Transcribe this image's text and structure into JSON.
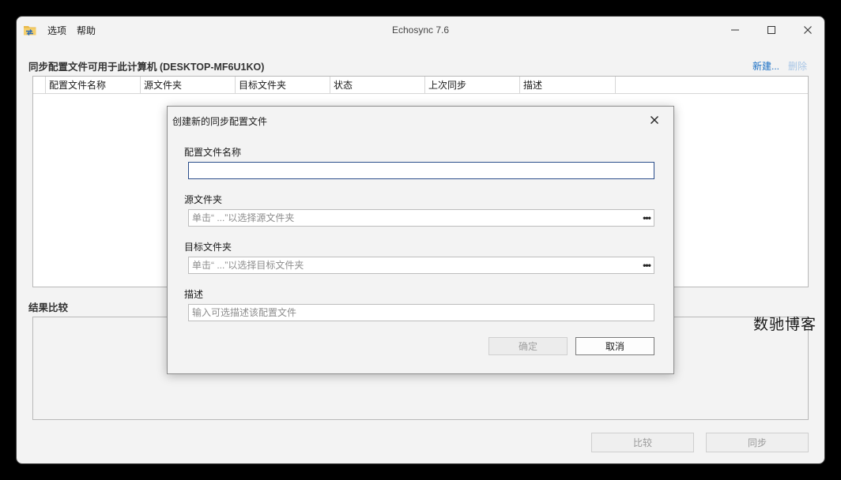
{
  "window": {
    "title": "Echosync 7.6",
    "menu": {
      "options": "选项",
      "help": "帮助"
    }
  },
  "profiles": {
    "heading": "同步配置文件可用于此计算机 (DESKTOP-MF6U1KO)",
    "new_link": "新建...",
    "delete_link": "删除",
    "columns": [
      "配置文件名称",
      "源文件夹",
      "目标文件夹",
      "状态",
      "上次同步",
      "描述"
    ]
  },
  "compare": {
    "heading": "结果比较"
  },
  "bottom_buttons": {
    "compare": "比较",
    "sync": "同步"
  },
  "dialog": {
    "title": "创建新的同步配置文件",
    "name_label": "配置文件名称",
    "name_value": "",
    "source_label": "源文件夹",
    "source_placeholder": "单击“ ...”以选择源文件夹",
    "target_label": "目标文件夹",
    "target_placeholder": "单击“ ...”以选择目标文件夹",
    "desc_label": "描述",
    "desc_placeholder": "输入可选描述该配置文件",
    "browse_label": "•••",
    "ok": "确定",
    "cancel": "取消"
  },
  "watermark": "数驰博客",
  "colors": {
    "link": "#1a6fc4",
    "link_disabled": "#a9c6e6",
    "focus_border": "#2a4d8a"
  }
}
